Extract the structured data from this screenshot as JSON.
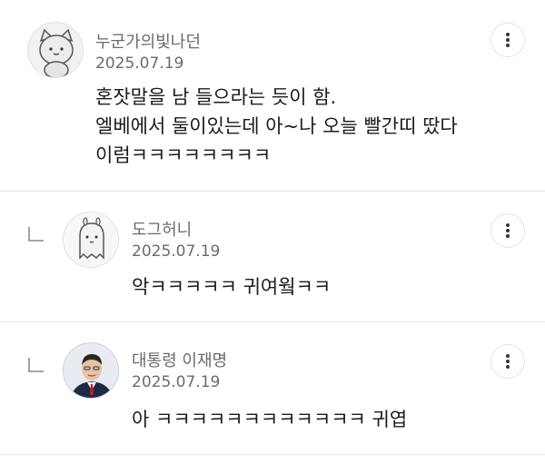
{
  "comments": [
    {
      "author": "누군가의빛나던",
      "date": "2025.07.19",
      "text": "혼잣말을 남 들으라는 듯이 함.\n엘베에서 둘이있는데 아~나 오늘 빨간띠 땄다\n이럼ㅋㅋㅋㅋㅋㅋㅋㅋ",
      "is_reply": false,
      "avatar_icon": "cat-character-avatar-icon"
    },
    {
      "author": "도그허니",
      "date": "2025.07.19",
      "text": "악ㅋㅋㅋㅋㅋ 귀여웤ㅋㅋ",
      "is_reply": true,
      "avatar_icon": "ghost-character-avatar-icon"
    },
    {
      "author": "대통령 이재명",
      "date": "2025.07.19",
      "text": "아 ㅋㅋㅋㅋㅋㅋㅋㅋㅋㅋㅋㅋ 귀엽",
      "is_reply": true,
      "avatar_icon": "person-photo-avatar-icon"
    }
  ],
  "colors": {
    "meta_text": "#6b6b6b",
    "body_text": "#1b1b1b",
    "divider": "#e6e6e6"
  }
}
